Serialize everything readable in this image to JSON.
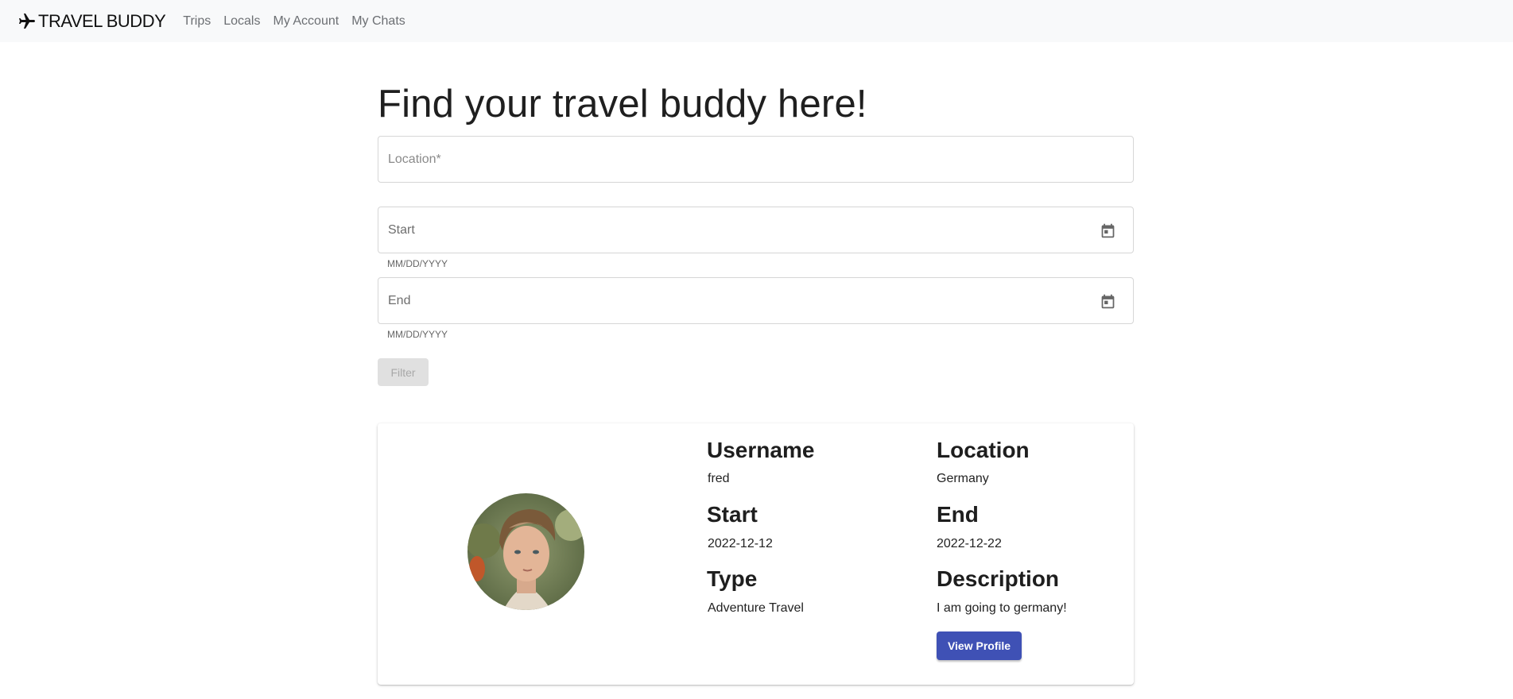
{
  "navbar": {
    "brand": "TRAVEL BUDDY",
    "links": [
      "Trips",
      "Locals",
      "My Account",
      "My Chats"
    ]
  },
  "page": {
    "title": "Find your travel buddy here!"
  },
  "form": {
    "location_placeholder": "Location*",
    "start_placeholder": "Start",
    "start_helper": "MM/DD/YYYY",
    "end_placeholder": "End",
    "end_helper": "MM/DD/YYYY",
    "filter_label": "Filter"
  },
  "card": {
    "username_label": "Username",
    "username": "fred",
    "location_label": "Location",
    "location": "Germany",
    "start_label": "Start",
    "start": "2022-12-12",
    "end_label": "End",
    "end": "2022-12-22",
    "type_label": "Type",
    "type": "Adventure Travel",
    "description_label": "Description",
    "description": "I am going to germany!",
    "view_profile_label": "View Profile"
  },
  "icons": {
    "brand": "airplane-icon",
    "date": "calendar-icon"
  },
  "colors": {
    "primary": "#3f51b5",
    "navbar_bg": "#f8f9fa",
    "disabled_button": "#e0e0e0"
  }
}
